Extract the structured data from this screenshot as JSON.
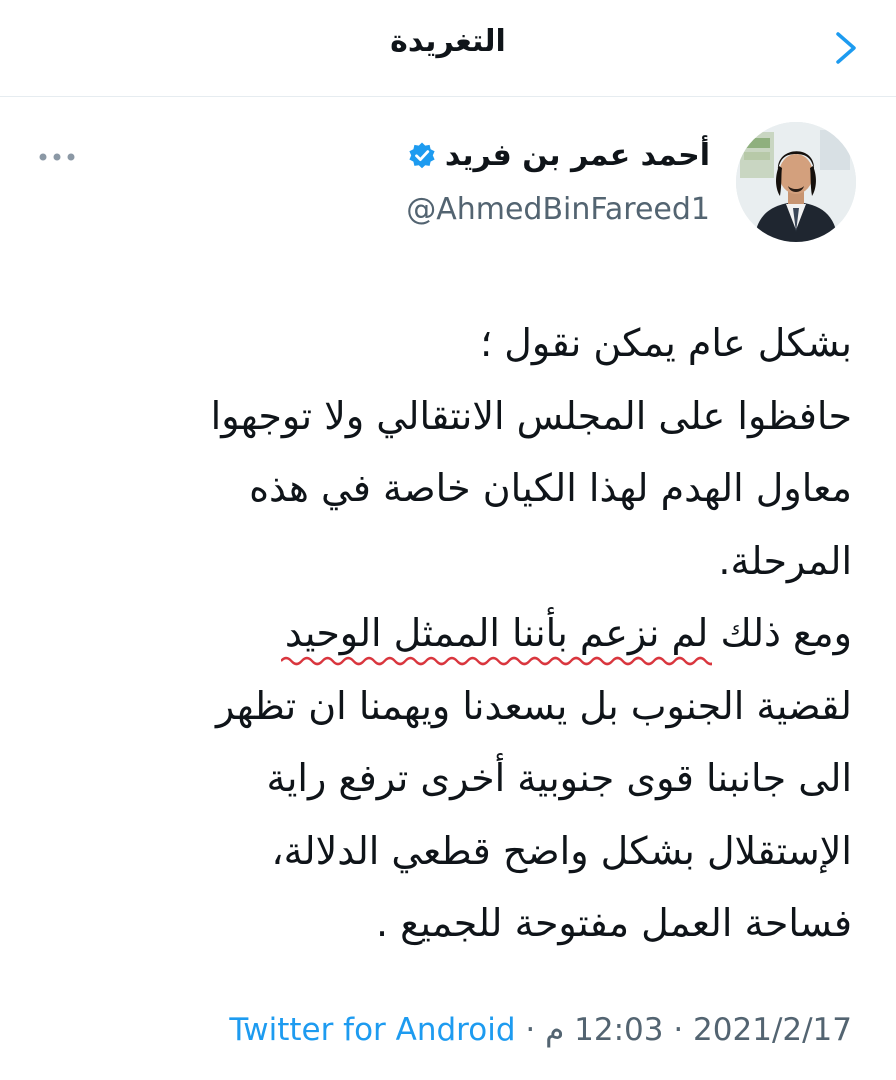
{
  "header": {
    "title": "التغريدة",
    "back_icon": "chevron-right-icon"
  },
  "author": {
    "name": "أحمد عمر بن فريد",
    "handle": "@AhmedBinFareed1",
    "verified": true
  },
  "tweet": {
    "line1": "بشكل عام يمكن نقول ؛",
    "line2": "حافظوا على المجلس الانتقالي ولا توجهوا",
    "line3": "معاول الهدم لهذا الكيان خاصة في هذه",
    "line4": "المرحلة.",
    "line5_start": "ومع ذلك ",
    "line5_underlined": "لم نزعم بأننا الممثل الوحيد",
    "line6": "لقضية الجنوب بل يسعدنا ويهمنا ان تظهر",
    "line7": "الى جانبنا قوى جنوبية أخرى ترفع راية",
    "line8": "الإستقلال بشكل واضح قطعي الدلالة،",
    "line9": "فساحة العمل مفتوحة للجميع ."
  },
  "meta": {
    "source": "Twitter for Android",
    "separator1": " · ",
    "time": "12:03 م",
    "separator2": " · ",
    "date": "2021/2/17"
  },
  "colors": {
    "accent": "#1d9bf0",
    "secondary_text": "#536471",
    "underline": "#d9363e",
    "divider": "#e6ecf0"
  }
}
